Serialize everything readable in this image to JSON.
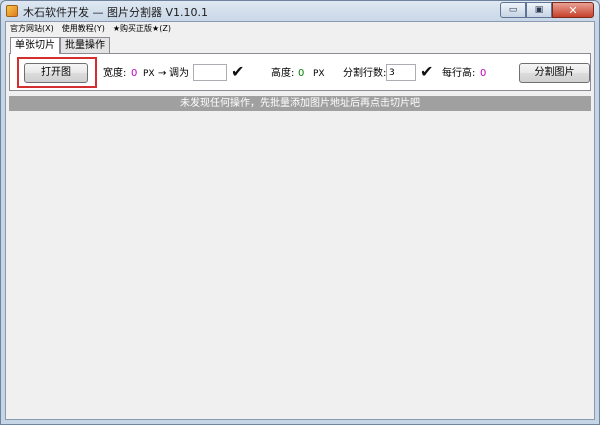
{
  "window": {
    "title": "木石软件开发 — 图片分割器 V1.10.1",
    "minimize_glyph": "▭",
    "maximize_glyph": "▣",
    "close_glyph": "✕"
  },
  "menu": [
    {
      "label": "官方网站(X)"
    },
    {
      "label": "使用教程(Y)"
    },
    {
      "label": "★购买正版★(Z)"
    }
  ],
  "tabs": [
    {
      "label": "单张切片",
      "active": true
    },
    {
      "label": "批量操作",
      "active": false
    }
  ],
  "toolbar": {
    "open_button": "打开图",
    "width_label": "宽度:",
    "width_value": "0",
    "width_unit": "PX",
    "arrow": "→",
    "resize_label": "调为",
    "resize_value": "",
    "check_glyph": "✔",
    "height_label": "高度:",
    "height_value": "0",
    "height_unit": "PX",
    "rows_label": "分割行数:",
    "rows_value": "3",
    "row_height_label": "每行高:",
    "row_height_value": "0",
    "split_button": "分割图片"
  },
  "status_message": "未发现任何操作，先批量添加图片地址后再点击切片吧",
  "colors": {
    "highlight": "#d32f2f",
    "width_value": "#c000c0",
    "height_value": "#008000",
    "row_height_value": "#c000c0",
    "status_bg": "#a0a0a0"
  }
}
